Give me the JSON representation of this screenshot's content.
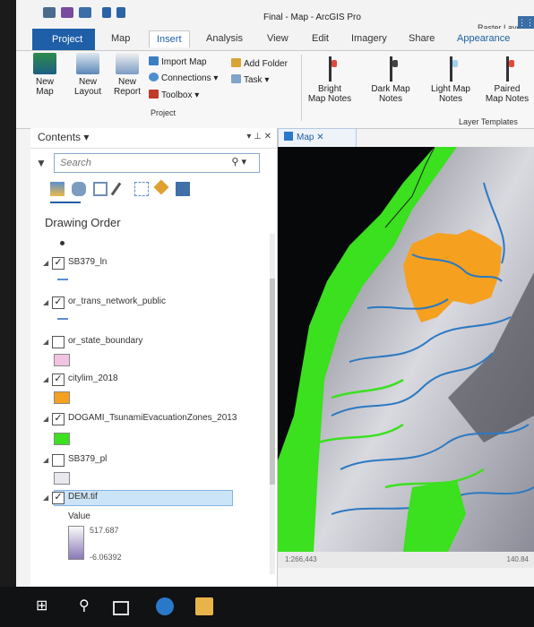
{
  "window": {
    "title": "Final - Map - ArcGIS Pro",
    "contextual_tab": "Raster Layer"
  },
  "tabs": [
    {
      "label": "Project"
    },
    {
      "label": "Map"
    },
    {
      "label": "Insert"
    },
    {
      "label": "Analysis"
    },
    {
      "label": "View"
    },
    {
      "label": "Edit"
    },
    {
      "label": "Imagery"
    },
    {
      "label": "Share"
    },
    {
      "label": "Appearance"
    }
  ],
  "ribbon": {
    "project_group": {
      "label": "Project",
      "new_map": "New\nMap",
      "new_layout": "New\nLayout",
      "new_report": "New\nReport",
      "import_map": "Import Map",
      "connections": "Connections",
      "toolbox": "Toolbox",
      "add_folder": "Add Folder",
      "task": "Task"
    },
    "layer_templates": {
      "label": "Layer Templates",
      "bright": "Bright\nMap Notes",
      "dark": "Dark Map\nNotes",
      "light": "Light Map\nNotes",
      "paired": "Paired\nMap Notes"
    }
  },
  "contents": {
    "title": "Contents",
    "search_placeholder": "Search",
    "drawing_order": "Drawing Order",
    "layers": [
      {
        "name": "SB379_ln",
        "checked": true
      },
      {
        "name": "or_trans_network_public",
        "checked": true
      },
      {
        "name": "or_state_boundary",
        "checked": false
      },
      {
        "name": "citylim_2018",
        "checked": true
      },
      {
        "name": "DOGAMI_TsunamiEvacuationZones_2013",
        "checked": true
      },
      {
        "name": "SB379_pl",
        "checked": false
      },
      {
        "name": "DEM.tif",
        "checked": true
      }
    ],
    "dem_legend": {
      "label": "Value",
      "high": "517.687",
      "low": "-6.06392"
    }
  },
  "map": {
    "tab_label": "Map",
    "scale": "1:266,443",
    "coords": "140.84"
  },
  "colors": {
    "accent": "#1e5fa8",
    "green": "#3be01f",
    "orange": "#f5a01f",
    "water": "#2b79c2",
    "state_fill": "#f2c3e0"
  }
}
